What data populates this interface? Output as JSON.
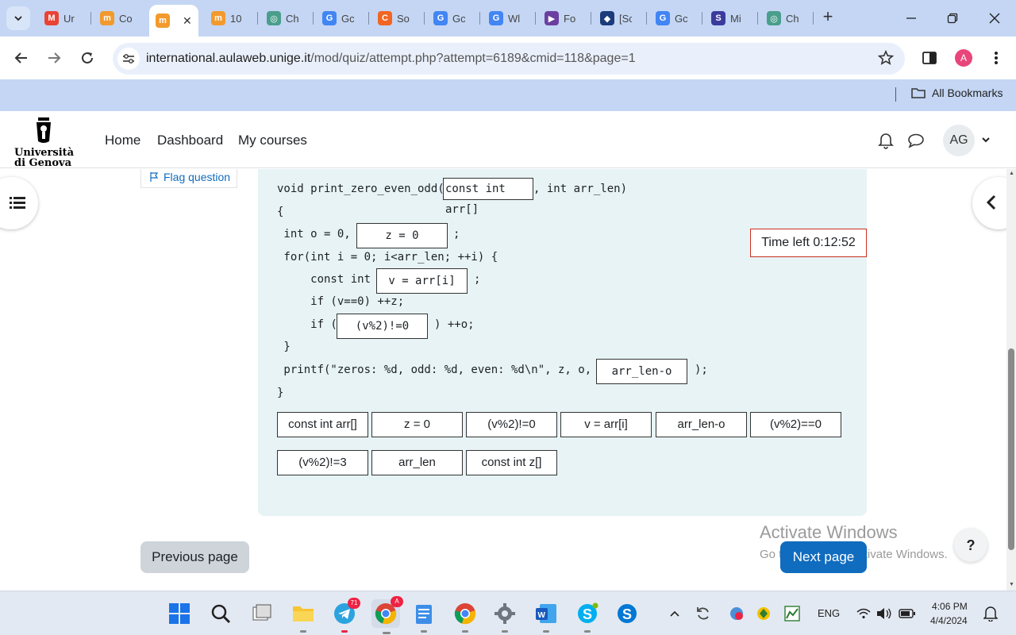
{
  "browser": {
    "tabs": [
      {
        "title": "Ur",
        "fav": "M",
        "color": "#ea4335"
      },
      {
        "title": "Co",
        "fav": "m",
        "color": "#f29a2e"
      },
      {
        "title": "",
        "fav": "m",
        "color": "#f29a2e",
        "active": true
      },
      {
        "title": "10",
        "fav": "m",
        "color": "#f29a2e"
      },
      {
        "title": "Ch",
        "fav": "◎",
        "color": "#4a9e8c"
      },
      {
        "title": "Gc",
        "fav": "G",
        "color": "#4285f4"
      },
      {
        "title": "So",
        "fav": "C",
        "color": "#f26522"
      },
      {
        "title": "Gc",
        "fav": "G",
        "color": "#4285f4"
      },
      {
        "title": "Wl",
        "fav": "G",
        "color": "#4285f4"
      },
      {
        "title": "Fo",
        "fav": "▶",
        "color": "#6b3fa0"
      },
      {
        "title": "[Sc",
        "fav": "◆",
        "color": "#1a3c7a"
      },
      {
        "title": "Gc",
        "fav": "G",
        "color": "#4285f4"
      },
      {
        "title": "Mi",
        "fav": "S",
        "color": "#3b3b9e"
      },
      {
        "title": "Ch",
        "fav": "◎",
        "color": "#4a9e8c"
      }
    ],
    "close_glyph": "✕",
    "new_tab_glyph": "+",
    "url_host": "international.aulaweb.unige.it",
    "url_path": "/mod/quiz/attempt.php?attempt=6189&cmid=118&page=1",
    "profile_initial": "A",
    "all_bookmarks": "All Bookmarks"
  },
  "moodle": {
    "logo_line1": "Università",
    "logo_line2": "di Genova",
    "nav": [
      "Home",
      "Dashboard",
      "My courses"
    ],
    "avatar_initials": "AG"
  },
  "quiz": {
    "flag_label": "Flag question",
    "timer": "Time left 0:12:52",
    "code": {
      "l1_pre": "void print_zero_even_odd(",
      "l1_post": ", int arr_len)",
      "l2": "{",
      "l3_pre": " int o = 0,",
      "l3_post": ";",
      "l4": " for(int i = 0; i<arr_len; ++i) {",
      "l5_pre": "     const int",
      "l5_post": ";",
      "l6": "     if (v==0) ++z;",
      "l7_pre": "     if (",
      "l7_post": ") ++o;",
      "l8": " }",
      "l9_pre": " printf(\"zeros: %d, odd: %d, even: %d\\n\", z, o,",
      "l9_post": ");",
      "l10": "}"
    },
    "drops": [
      "const int arr[]",
      "z = 0",
      "v = arr[i]",
      "(v%2)!=0",
      "arr_len-o"
    ],
    "choices": [
      "const int arr[]",
      "z = 0",
      "(v%2)!=0",
      "v = arr[i]",
      "arr_len-o",
      "(v%2)==0",
      "(v%2)!=3",
      "arr_len",
      "const int z[]"
    ],
    "prev_page": "Previous page",
    "next_page": "Next page",
    "help": "?"
  },
  "watermark": {
    "line1": "Activate Windows",
    "line2": "Go to Settings to activate Windows."
  },
  "taskbar": {
    "telegram_badge": "71",
    "chrome_badge": "A",
    "lang": "ENG",
    "time": "4:06 PM",
    "date": "4/4/2024"
  }
}
